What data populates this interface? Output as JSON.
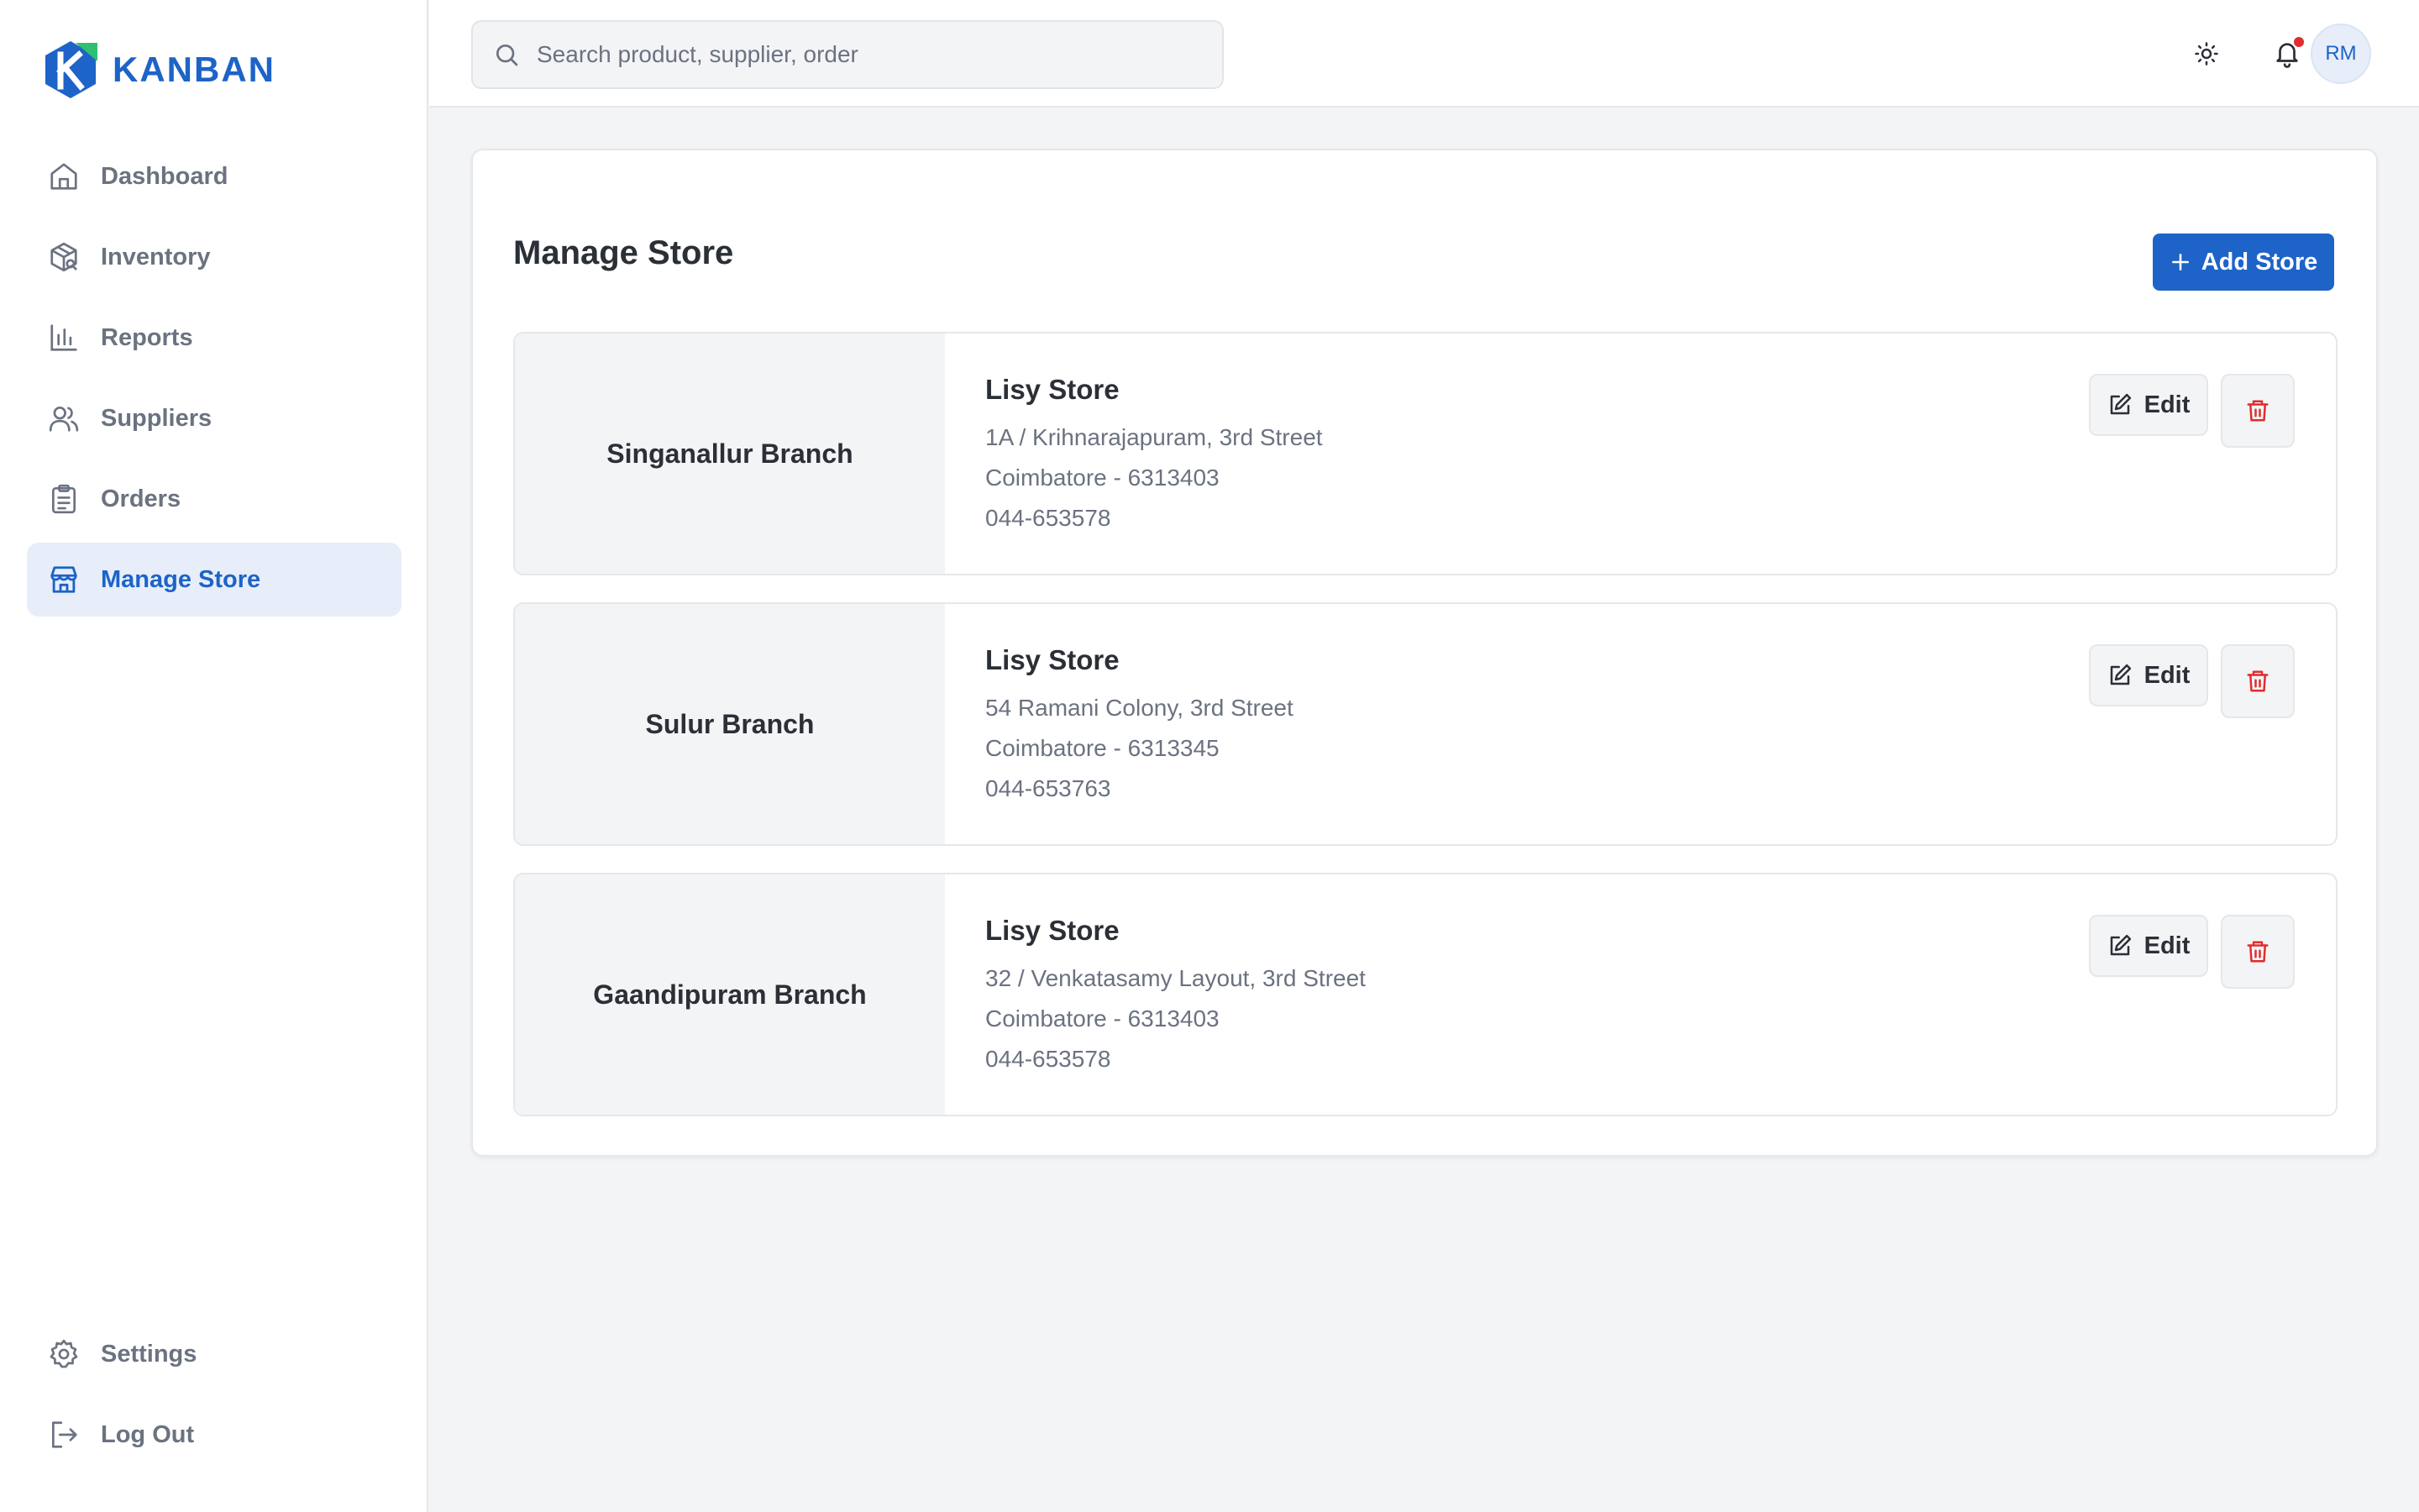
{
  "app": {
    "name": "KANBAN"
  },
  "colors": {
    "accent": "#1d63c8",
    "danger": "#e02d2d",
    "background": "#f3f4f6"
  },
  "sidebar": {
    "items": [
      {
        "label": "Dashboard",
        "icon": "home-icon"
      },
      {
        "label": "Inventory",
        "icon": "package-icon"
      },
      {
        "label": "Reports",
        "icon": "bar-chart-icon"
      },
      {
        "label": "Suppliers",
        "icon": "users-icon"
      },
      {
        "label": "Orders",
        "icon": "clipboard-icon"
      },
      {
        "label": "Manage Store",
        "icon": "store-icon",
        "active": true
      }
    ],
    "bottom_items": [
      {
        "label": "Settings",
        "icon": "gear-icon"
      },
      {
        "label": "Log Out",
        "icon": "logout-icon"
      }
    ]
  },
  "header": {
    "search_placeholder": "Search product, supplier, order",
    "user_initials": "RM"
  },
  "main": {
    "title": "Manage Store",
    "add_button_label": "Add Store",
    "edit_label": "Edit",
    "stores": [
      {
        "branch": "Singanallur Branch",
        "name": "Lisy Store",
        "address": "1A / Krihnarajapuram, 3rd Street",
        "city": "Coimbatore - 6313403",
        "phone": "044-653578"
      },
      {
        "branch": "Sulur Branch",
        "name": "Lisy Store",
        "address": "54 Ramani Colony, 3rd Street",
        "city": "Coimbatore - 6313345",
        "phone": "044-653763"
      },
      {
        "branch": "Gaandipuram Branch",
        "name": "Lisy Store",
        "address": "32 / Venkatasamy Layout, 3rd Street",
        "city": "Coimbatore - 6313403",
        "phone": "044-653578"
      }
    ]
  }
}
